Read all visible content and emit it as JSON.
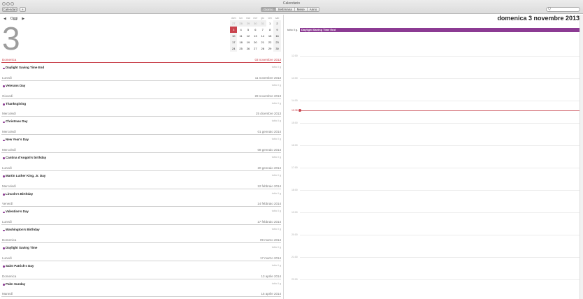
{
  "window": {
    "title": "Calendario"
  },
  "toolbar": {
    "calendars_label": "Calendari",
    "add_label": "+",
    "views": [
      {
        "label": "Giorno",
        "active": true
      },
      {
        "label": "Settimana",
        "active": false
      },
      {
        "label": "Mese",
        "active": false
      },
      {
        "label": "Anno",
        "active": false
      }
    ],
    "search_placeholder": "Q"
  },
  "nav": {
    "prev": "◀",
    "today": "Oggi",
    "next": "▶"
  },
  "big_day": "3",
  "minical": {
    "weekdays": [
      "dom",
      "lun",
      "mar",
      "mer",
      "gio",
      "ven",
      "sab"
    ],
    "weeks": [
      [
        "27",
        "28",
        "29",
        "30",
        "31",
        "1",
        "2"
      ],
      [
        "3",
        "4",
        "5",
        "6",
        "7",
        "8",
        "9"
      ],
      [
        "10",
        "11",
        "12",
        "13",
        "14",
        "15",
        "16"
      ],
      [
        "17",
        "18",
        "19",
        "20",
        "21",
        "22",
        "23"
      ],
      [
        "24",
        "25",
        "26",
        "27",
        "28",
        "29",
        "30"
      ]
    ]
  },
  "events": [
    {
      "weekday": "Domenica",
      "date": "03 novembre 2013",
      "name": "Daylight Saving Time End",
      "allday": "tutto il g",
      "today": true
    },
    {
      "weekday": "Lunedì",
      "date": "11 novembre 2013",
      "name": "Veterans Day",
      "allday": "tutto il g"
    },
    {
      "weekday": "Giovedì",
      "date": "28 novembre 2013",
      "name": "Thanksgiving",
      "allday": "tutto il g"
    },
    {
      "weekday": "Mercoledì",
      "date": "25 dicembre 2013",
      "name": "Christmas Day",
      "allday": "tutto il g"
    },
    {
      "weekday": "Mercoledì",
      "date": "01 gennaio 2014",
      "name": "New Year's Day",
      "allday": "tutto il g"
    },
    {
      "weekday": "Mercoledì",
      "date": "08 gennaio 2014",
      "name": "Cantina d'Angoli's birthday",
      "allday": "tutto il g"
    },
    {
      "weekday": "Lunedì",
      "date": "20 gennaio 2014",
      "name": "Martin Luther King, Jr. Day",
      "allday": "tutto il g"
    },
    {
      "weekday": "Mercoledì",
      "date": "12 febbraio 2014",
      "name": "Lincoln's Birthday",
      "allday": "tutto il g"
    },
    {
      "weekday": "Venerdì",
      "date": "14 febbraio 2014",
      "name": "Valentine's Day",
      "allday": "tutto il g"
    },
    {
      "weekday": "Lunedì",
      "date": "17 febbraio 2014",
      "name": "Washington's Birthday",
      "allday": "tutto il g"
    },
    {
      "weekday": "Domenica",
      "date": "09 marzo 2014",
      "name": "Daylight Saving Time",
      "allday": "tutto il g"
    },
    {
      "weekday": "Lunedì",
      "date": "17 marzo 2014",
      "name": "Saint Patrick's Day",
      "allday": "tutto il g"
    },
    {
      "weekday": "Domenica",
      "date": "13 aprile 2014",
      "name": "Palm Sunday",
      "allday": "tutto il g"
    },
    {
      "weekday": "Martedì",
      "date": "15 aprile 2014",
      "name": "",
      "allday": ""
    }
  ],
  "right": {
    "title": "domenica 3 novembre 2013",
    "allday_label": "tutto il g.",
    "allday_event": "Daylight Saving Time End",
    "hours": [
      "12:00",
      "13:00",
      "14:00",
      "15:00",
      "16:00",
      "17:00",
      "18:00",
      "19:00",
      "20:00",
      "21:00",
      "22:00"
    ],
    "now_label": "15:38"
  },
  "colors": {
    "accent": "#c9434d",
    "event": "#8c3b93"
  }
}
